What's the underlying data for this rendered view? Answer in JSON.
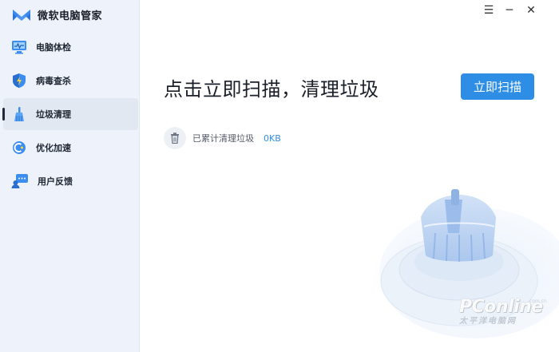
{
  "app": {
    "title": "微软电脑管家"
  },
  "sidebar": {
    "items": [
      {
        "label": "电脑体检",
        "icon": "monitor-icon"
      },
      {
        "label": "病毒查杀",
        "icon": "shield-icon"
      },
      {
        "label": "垃圾清理",
        "icon": "broom-icon",
        "active": true
      },
      {
        "label": "优化加速",
        "icon": "rocket-icon"
      },
      {
        "label": "用户反馈",
        "icon": "feedback-icon"
      }
    ]
  },
  "window_controls": {
    "menu": "☰",
    "minimize": "─",
    "close": "✕"
  },
  "main": {
    "headline": "点击立即扫描，清理垃圾",
    "scan_button": "立即扫描",
    "stat_label": "已累计清理垃圾",
    "stat_value": "0KB"
  },
  "watermark": {
    "main": "PConline",
    "sub": "太平洋电脑网",
    "domain": ".com.cn"
  },
  "colors": {
    "accent": "#2e8ee6",
    "sidebar_bg": "#eef3fb"
  }
}
